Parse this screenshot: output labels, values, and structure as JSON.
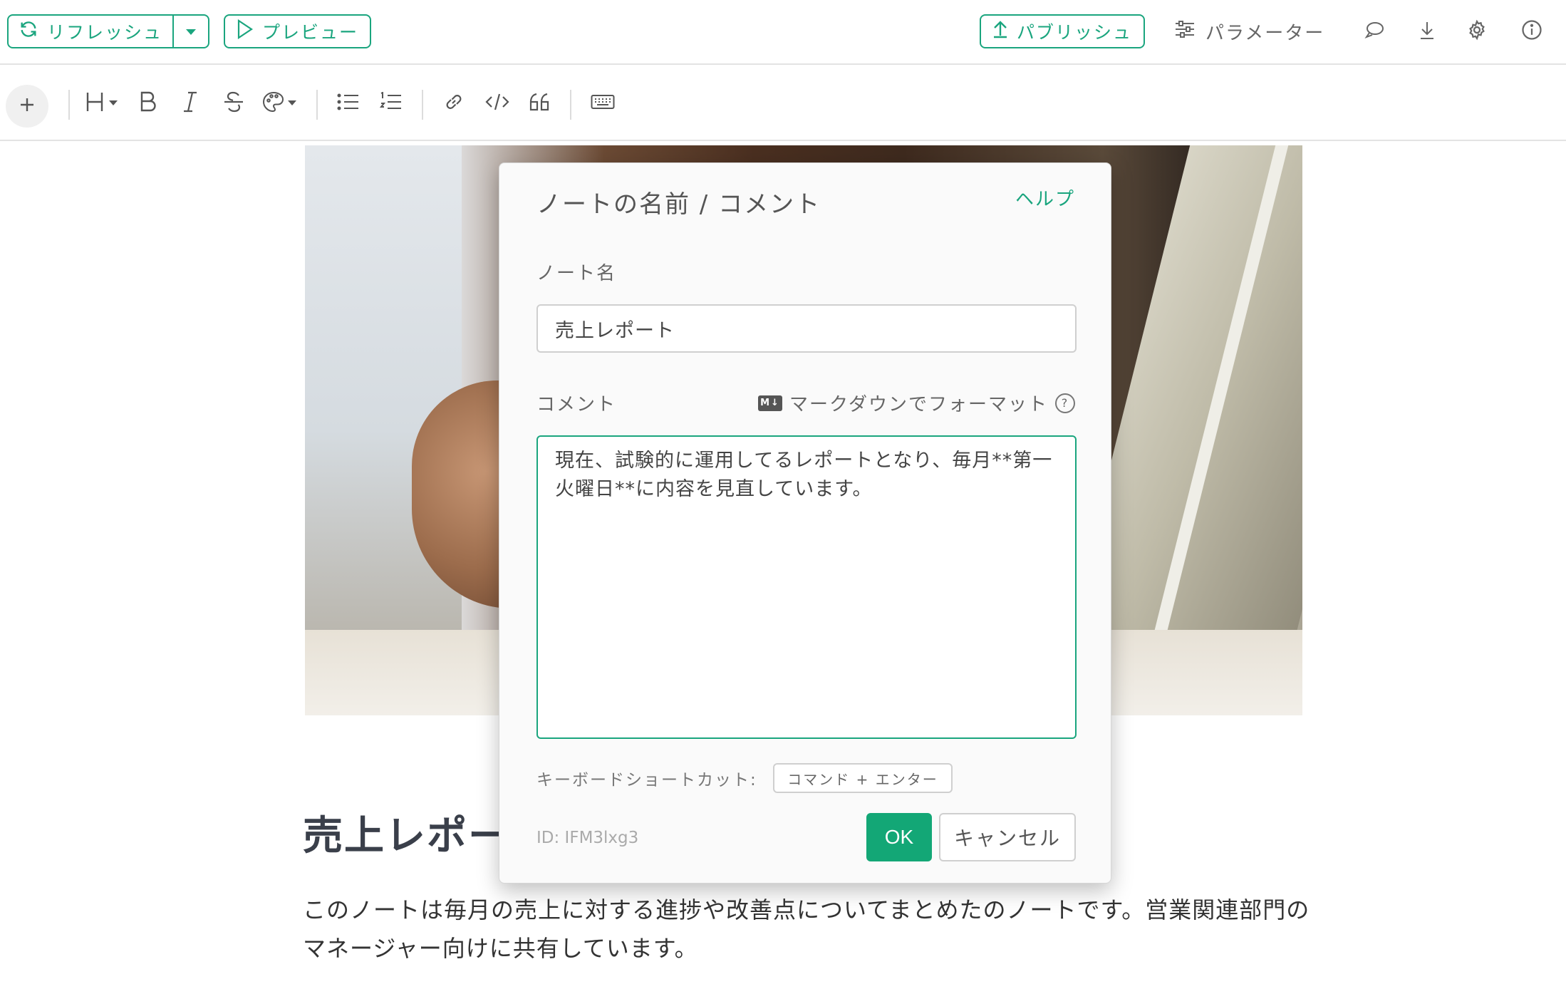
{
  "topbar": {
    "refresh_label": "リフレッシュ",
    "preview_label": "プレビュー",
    "publish_label": "パブリッシュ",
    "parameters_label": "パラメーター"
  },
  "document": {
    "title": "売上レポート",
    "body": "このノートは毎月の売上に対する進捗や改善点についてまとめたのノートです。営業関連部門のマネージャー向けに共有しています。"
  },
  "modal": {
    "title": "ノートの名前 / コメント",
    "help_label": "ヘルプ",
    "note_name_label": "ノート名",
    "note_name_value": "売上レポート",
    "comment_label": "コメント",
    "markdown_badge": "M↓",
    "markdown_hint": "マークダウンでフォーマット",
    "comment_value": "現在、試験的に運用してるレポートとなり、毎月**第一火曜日**に内容を見直しています。",
    "shortcut_label": "キーボードショートカット:",
    "shortcut_value": "コマンド + エンター",
    "note_id": "ID: IFM3lxg3",
    "ok_label": "OK",
    "cancel_label": "キャンセル"
  },
  "colors": {
    "accent": "#1aa57e",
    "ok_button": "#13a776"
  }
}
